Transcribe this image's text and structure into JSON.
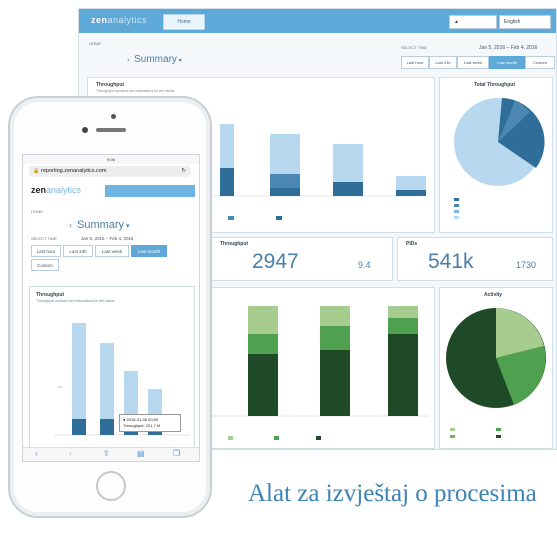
{
  "desktop": {
    "logo_main": "zen",
    "logo_sub": "analytics",
    "home_tab": "Home",
    "user_label": "▲",
    "language": "English",
    "breadcrumb": "HOME",
    "page_title": "Summary",
    "select_time_label": "SELECT TIME",
    "date_range": "Jan 5, 2016 – Feb 4, 2016",
    "time_buttons": [
      "Last hour",
      "Last 24h",
      "Last week",
      "Last month",
      "Custom"
    ],
    "active_time_button": "Last month",
    "throughput_card": {
      "title": "Throughput",
      "subtitle": "Throughput numbers are estimations for the status",
      "value_label": "Throughput",
      "big_value": "2947",
      "small_value": "9.4"
    },
    "total_throughput": {
      "title": "Total Throughput"
    },
    "pids_card": {
      "title": "PIDs",
      "big_value": "541k",
      "small_value": "1730"
    },
    "activity": {
      "title": "Activity"
    },
    "colors": {
      "accent": "#5fa9d9",
      "dark_blue": "#2f6e98",
      "light_blue": "#b7d8ef",
      "dark_green": "#1f4a27",
      "mid_green": "#4fa04f",
      "light_green": "#a7cc8f"
    }
  },
  "mobile": {
    "status_time": "9:06",
    "url": "reporting.zenanalytics.com",
    "logo_main": "zen",
    "logo_sub": "analytics",
    "breadcrumb": "HOME",
    "page_title": "Summary",
    "select_time_label": "SELECT TIME",
    "date_range": "Jan 5, 2016 – Feb 4, 2016",
    "time_buttons": [
      "Last hour",
      "Last 24h",
      "Last week",
      "Last month",
      "Custom"
    ],
    "active_time_button": "Last month",
    "card_title": "Throughput",
    "card_subtitle": "Throughput numbers are estimations for the status",
    "tooltip_line1": "● 2016-01-06 00:00",
    "tooltip_line2": "Throughput: 221.7 M"
  },
  "caption": "Alat za izvještaj o procesima"
}
